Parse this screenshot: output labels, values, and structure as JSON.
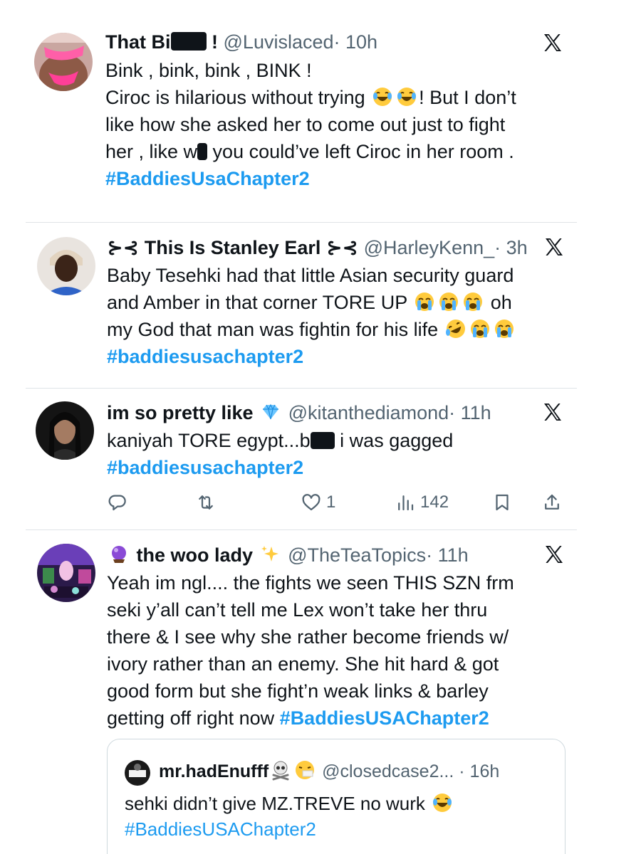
{
  "tweets": [
    {
      "name_a": "That Bi",
      "name_b": " !",
      "handle": "@Luvislaced",
      "time": "· 10h",
      "lines": [
        "Bink , bink, bink , BINK !",
        "Ciroc is hilarious without trying",
        "!  But I don’t",
        "like how she asked her to come out just to fight",
        "her , like w",
        " you could’ve left Ciroc in her room ."
      ],
      "hashtag": "#BaddiesUsaChapter2",
      "avatar_icon": "pink-outfit-avatar",
      "menu_icon": "x-logo-icon"
    },
    {
      "name_prefix": "⊱⊰ ",
      "name": "This Is Stanley Earl",
      "name_suffix": " ⊱⊰",
      "handle": "@HarleyKenn_",
      "time": "· 3h",
      "lines": [
        "Baby Tesehki had that little Asian security guard",
        "and Amber in that corner TORE UP",
        "oh",
        "my God that man was fightin for his life"
      ],
      "hashtag": "#baddiesusachapter2",
      "avatar_icon": "woman-selfie-avatar",
      "menu_icon": "x-logo-icon"
    },
    {
      "name": "im so pretty like",
      "handle": "@kitanthediamond",
      "time": "· 11h",
      "line_a": "kaniyah TORE egypt...b",
      "line_b": " i was gagged",
      "hashtag": "#baddiesusachapter2",
      "avatar_icon": "dark-hair-avatar",
      "menu_icon": "x-logo-icon",
      "actions": {
        "reply_icon": "reply-icon",
        "retweet_icon": "retweet-icon",
        "like_icon": "heart-icon",
        "like_count": "1",
        "views_icon": "views-icon",
        "views_count": "142",
        "bookmark_icon": "bookmark-icon",
        "share_icon": "share-icon"
      }
    },
    {
      "name": "the woo lady",
      "handle": "@TheTeaTopics",
      "time": "· 11h",
      "lines": [
        "Yeah im ngl.... the fights we seen THIS SZN frm",
        "seki y’all can’t tell me Lex won’t take her thru",
        "there & I see why she rather become friends w/",
        "ivory rather than an enemy. She hit hard & got",
        "good form but she fight’n weak links & barley",
        "getting off right now"
      ],
      "hashtag": "#BaddiesUSAChapter2",
      "avatar_icon": "purple-collage-avatar",
      "menu_icon": "x-logo-icon",
      "quote": {
        "name": "mr.hadEnufff",
        "handle": "@closedcase2...",
        "time": "· 16h",
        "text": "sehki didn’t give MZ.TREVE no wurk",
        "hashtag": "#BaddiesUSAChapter2"
      }
    }
  ],
  "colors": {
    "text": "#0f1419",
    "secondary": "#536471",
    "link": "#1d9bf0",
    "divider": "#dfe3e7"
  }
}
